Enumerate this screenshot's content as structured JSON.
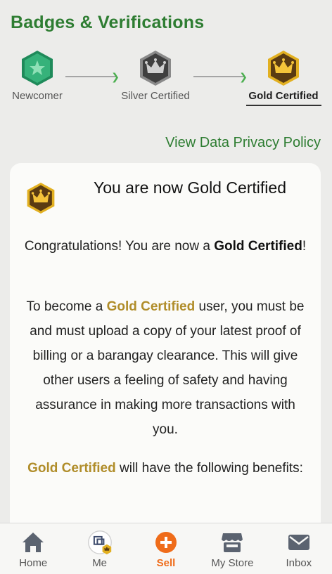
{
  "page": {
    "title": "Badges & Verifications"
  },
  "steps": [
    {
      "label": "Newcomer",
      "badge": "star-icon",
      "color": "#2e9e6b"
    },
    {
      "label": "Silver Certified",
      "badge": "crown-icon",
      "color": "#6a6a6a"
    },
    {
      "label": "Gold Certified",
      "badge": "crown-icon",
      "color": "#d4a20e",
      "active": true
    }
  ],
  "privacy_link": "View Data Privacy Policy",
  "card": {
    "title": "You are now Gold Certified",
    "congrats_prefix": "Congratulations! You are now a ",
    "congrats_bold": "Gold Certified",
    "congrats_suffix": "!",
    "body_prefix": "To become a ",
    "body_gold": "Gold Certified",
    "body_suffix": " user, you must be and must upload a copy of your latest proof of billing or a barangay clearance. This will give other users a feeling of safety and having assurance in making more transactions with you.",
    "benefits_gold": "Gold Certified",
    "benefits_suffix": " will have the following benefits:"
  },
  "nav": [
    {
      "label": "Home",
      "icon": "home-icon"
    },
    {
      "label": "Me",
      "icon": "avatar"
    },
    {
      "label": "Sell",
      "icon": "plus-circle-icon",
      "color": "#ef6c1a"
    },
    {
      "label": "My Store",
      "icon": "store-icon"
    },
    {
      "label": "Inbox",
      "icon": "mail-icon"
    }
  ]
}
